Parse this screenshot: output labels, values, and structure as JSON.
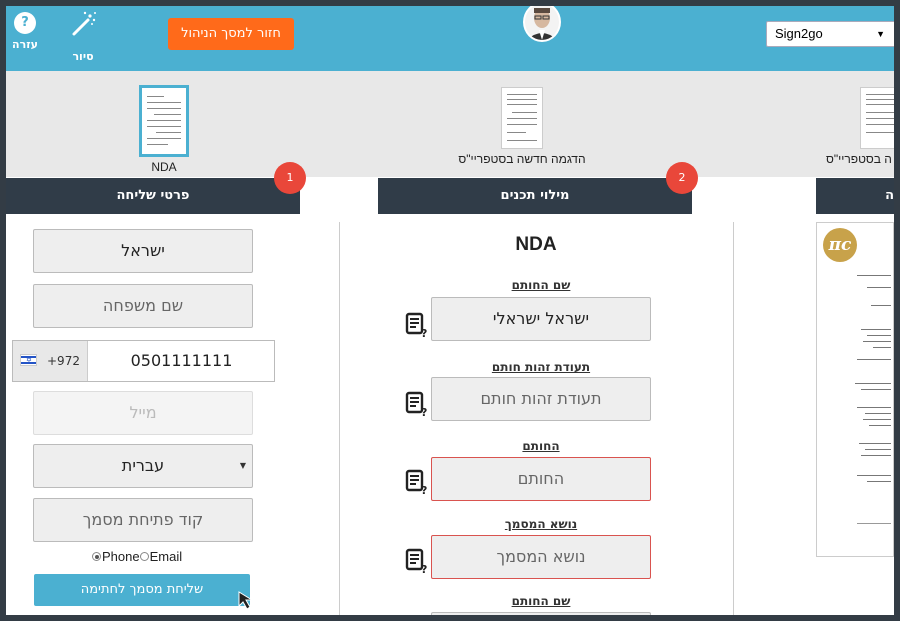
{
  "topbar": {
    "help_label": "עזרה",
    "help_symbol": "?",
    "tour_label": "סיור",
    "back_button": "חזור למסך הניהול",
    "org_select": {
      "selected": "Sign2go"
    }
  },
  "templates": [
    {
      "name": "NDA",
      "selected": true
    },
    {
      "name": "הדגמה חדשה בסטפריי\"ס",
      "selected": false
    },
    {
      "name": "ה בסטפריי\"ס",
      "selected": false
    }
  ],
  "steps": {
    "send_details": {
      "badge": "1",
      "title": "פרטי שליחה"
    },
    "fill_fields": {
      "badge": "2",
      "title": "מילוי תכנים"
    },
    "preview": {
      "title": "ה"
    }
  },
  "send_form": {
    "country": "ישראל",
    "last_name_placeholder": "שם משפחה",
    "phone_code": "+972",
    "phone_number": "0501111111",
    "email_placeholder": "מייל",
    "language": "עברית",
    "open_code_placeholder": "קוד פתיחת מסמך",
    "delivery_options": [
      "Phone",
      "Email"
    ],
    "delivery_selected": "Phone",
    "send_button": "שליחת מסמך לחתימה"
  },
  "fill_form": {
    "doc_title": "NDA",
    "fields": [
      {
        "label": "שם החותם",
        "value": "ישראל ישראלי",
        "is_placeholder": false,
        "required": false
      },
      {
        "label": "תעודת זהות חותם",
        "value": "תעודת זהות חותם",
        "is_placeholder": true,
        "required": false
      },
      {
        "label": "החותם",
        "value": "החותם",
        "is_placeholder": true,
        "required": true
      },
      {
        "label": "נושא המסמך",
        "value": "נושא המסמך",
        "is_placeholder": true,
        "required": true
      },
      {
        "label": "שם החותם",
        "value": "",
        "is_placeholder": true,
        "required": false
      }
    ]
  },
  "preview": {
    "logo_text": "πc"
  },
  "colors": {
    "topbar": "#4bb0d1",
    "orange_button": "#ff6a1a",
    "section_header": "#303c48",
    "step_badge": "#e9473a",
    "required_border": "#d9534f"
  }
}
